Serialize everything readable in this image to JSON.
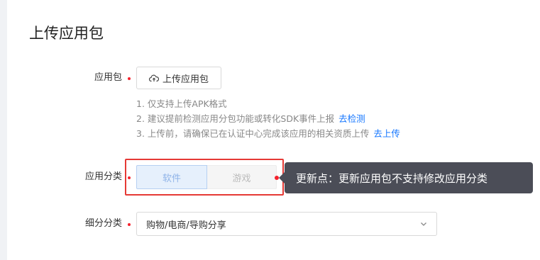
{
  "page": {
    "title": "上传应用包"
  },
  "upload": {
    "label": "应用包",
    "button_label": "上传应用包",
    "tips": [
      {
        "text": "1. 仅支持上传APK格式",
        "link": ""
      },
      {
        "text": "2. 建议提前检测应用分包功能或转化SDK事件上报",
        "link": "去检测"
      },
      {
        "text": "3. 上传前，请确保已在认证中心完成该应用的相关资质上传",
        "link": "去上传"
      }
    ]
  },
  "category": {
    "label": "应用分类",
    "options": [
      "软件",
      "游戏"
    ],
    "selected": "软件",
    "tooltip": "更新点：更新应用包不支持修改应用分类"
  },
  "subcategory": {
    "label": "细分分类",
    "value": "购物/电商/导购分享"
  },
  "colors": {
    "required": "#f5222d",
    "link": "#1677ff",
    "highlight_border": "#e53935",
    "tooltip_bg": "#4b4d57"
  },
  "icons": {
    "upload": "cloud-upload-icon",
    "select_arrow": "chevron-down-icon"
  }
}
